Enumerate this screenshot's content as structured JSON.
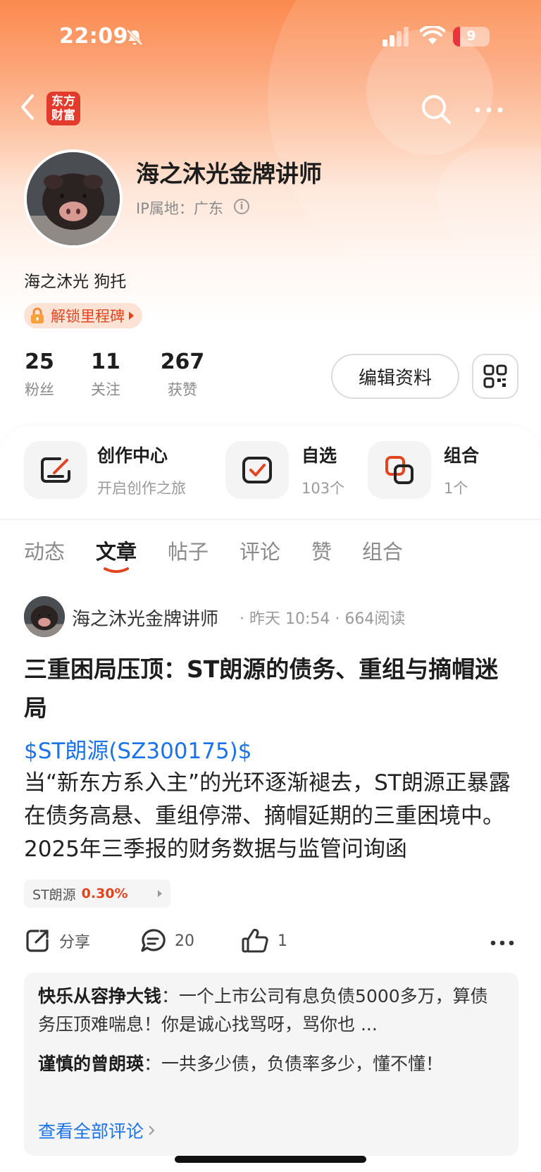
{
  "status_bar": {
    "time": "22:09",
    "battery_level": "9"
  },
  "nav": {
    "logo_text": "东方财富"
  },
  "profile": {
    "name": "海之沐光金牌讲师",
    "ip_location": "IP属地：广东",
    "bio": "海之沐光 狗托",
    "milestone_label": "解锁里程碑"
  },
  "stats": [
    {
      "value": "25",
      "label": "粉丝"
    },
    {
      "value": "11",
      "label": "关注"
    },
    {
      "value": "267",
      "label": "获赞"
    }
  ],
  "actions": {
    "edit_profile": "编辑资料"
  },
  "features": [
    {
      "title": "创作中心",
      "subtitle": "开启创作之旅"
    },
    {
      "title": "自选",
      "subtitle": "103个"
    },
    {
      "title": "组合",
      "subtitle": "1个"
    }
  ],
  "tabs": [
    "动态",
    "文章",
    "帖子",
    "评论",
    "赞",
    "组合"
  ],
  "active_tab": "文章",
  "post": {
    "author": "海之沐光金牌讲师",
    "time": "昨天 10:54",
    "reads": "664阅读",
    "title": "三重困局压顶：ST朗源的债务、重组与摘帽迷局",
    "stock_link": "$ST朗源(SZ300175)$",
    "body": "当“新东方系入主”的光环逐渐褪去，ST朗源正暴露在债务高悬、重组停滞、摘帽延期的三重困境中。2025年三季报的财务数据与监管问询函",
    "tag_name": "ST朗源",
    "tag_change": "0.30%",
    "share_label": "分享",
    "comment_count": "20",
    "like_count": "1"
  },
  "comments": [
    {
      "user": "快乐从容挣大钱",
      "text": "一个上市公司有息负债5000多万，算债务压顶难喘息！你是诚心找骂呀，骂你也 ..."
    },
    {
      "user": "谨慎的曾朗瑛",
      "text": "一共多少债，负债率多少，懂不懂！"
    }
  ],
  "view_all_comments": "查看全部评论",
  "colors": {
    "accent": "#e2441f",
    "link": "#1a73e8",
    "hero_top": "#fb8a4e"
  }
}
